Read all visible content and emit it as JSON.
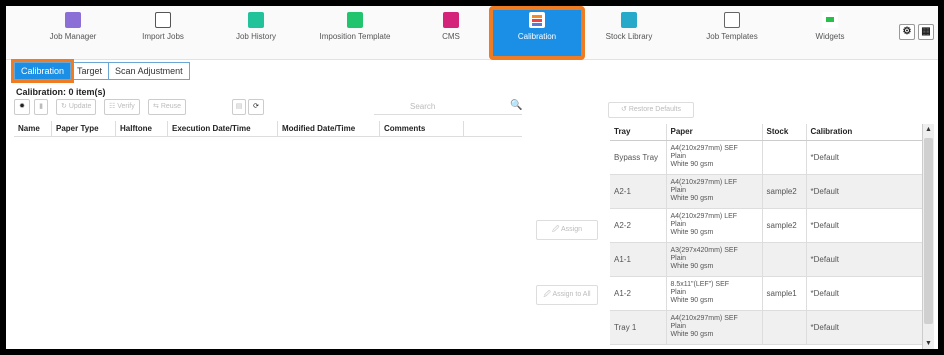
{
  "nav": {
    "items": [
      {
        "label": "Job Manager",
        "icon": "job-manager-icon"
      },
      {
        "label": "Import Jobs",
        "icon": "import-jobs-icon"
      },
      {
        "label": "Job History",
        "icon": "job-history-icon"
      },
      {
        "label": "Imposition Template",
        "icon": "imposition-template-icon"
      },
      {
        "label": "CMS",
        "icon": "cms-icon"
      },
      {
        "label": "Calibration",
        "icon": "calibration-icon"
      },
      {
        "label": "Stock Library",
        "icon": "stock-library-icon"
      },
      {
        "label": "Job Templates",
        "icon": "job-templates-icon"
      },
      {
        "label": "Widgets",
        "icon": "widgets-icon"
      }
    ],
    "active": "Calibration",
    "accent": "#1b8fe6",
    "highlight": "#ef7b22"
  },
  "subtabs": [
    "Calibration",
    "Target",
    "Scan Adjustment"
  ],
  "title": "Calibration: 0 item(s)",
  "toolbar": {
    "update": "Update",
    "verify": "Verify",
    "reuse": "Reuse",
    "search_placeholder": "Search"
  },
  "left_table": {
    "columns": [
      "Name",
      "Paper Type",
      "Halftone",
      "Execution Date/Time",
      "Modified Date/Time",
      "Comments"
    ]
  },
  "middle": {
    "assign": "Assign",
    "assign_all": "Assign to All"
  },
  "right": {
    "restore": "Restore Defaults",
    "columns": [
      "Tray",
      "Paper",
      "Stock",
      "Calibration"
    ],
    "rows": [
      {
        "tray": "Bypass Tray",
        "paper": [
          "A4(210x297mm) SEF",
          "Plain",
          "White 90 gsm"
        ],
        "stock": "",
        "calibration": "*Default"
      },
      {
        "tray": "A2-1",
        "paper": [
          "A4(210x297mm) LEF",
          "Plain",
          "White 90 gsm"
        ],
        "stock": "sample2",
        "calibration": "*Default"
      },
      {
        "tray": "A2-2",
        "paper": [
          "A4(210x297mm) LEF",
          "Plain",
          "White 90 gsm"
        ],
        "stock": "sample2",
        "calibration": "*Default"
      },
      {
        "tray": "A1-1",
        "paper": [
          "A3(297x420mm) SEF",
          "Plain",
          "White 90 gsm"
        ],
        "stock": "",
        "calibration": "*Default"
      },
      {
        "tray": "A1-2",
        "paper": [
          "8.5x11\"(LEF\") SEF",
          "Plain",
          "White 90 gsm"
        ],
        "stock": "sample1",
        "calibration": "*Default"
      },
      {
        "tray": "Tray 1",
        "paper": [
          "A4(210x297mm) SEF",
          "Plain",
          "White 90 gsm"
        ],
        "stock": "",
        "calibration": "*Default"
      }
    ]
  }
}
